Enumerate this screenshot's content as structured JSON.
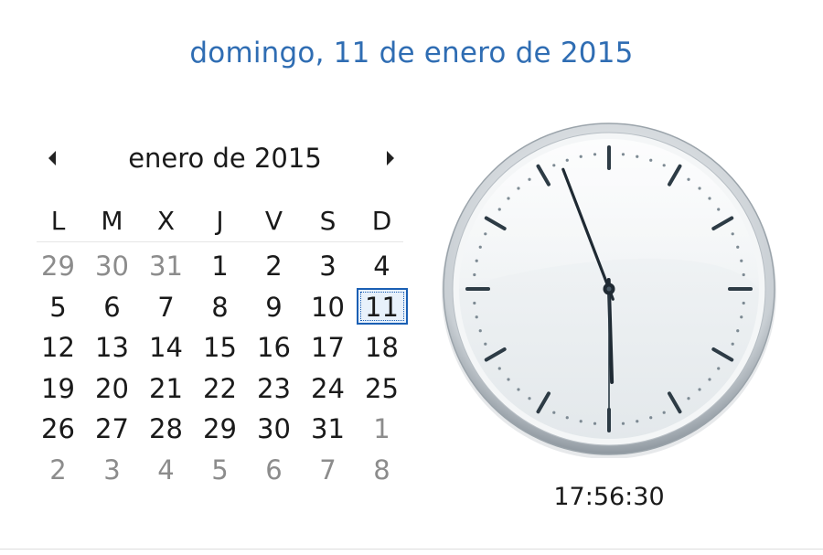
{
  "header": {
    "long_date": "domingo, 11 de enero de 2015"
  },
  "calendar": {
    "month_title": "enero de 2015",
    "prev_icon": "chevron-left-icon",
    "next_icon": "chevron-right-icon",
    "weekdays": [
      "L",
      "M",
      "X",
      "J",
      "V",
      "S",
      "D"
    ],
    "weeks": [
      [
        {
          "d": "29",
          "other": true
        },
        {
          "d": "30",
          "other": true
        },
        {
          "d": "31",
          "other": true
        },
        {
          "d": "1"
        },
        {
          "d": "2"
        },
        {
          "d": "3"
        },
        {
          "d": "4"
        }
      ],
      [
        {
          "d": "5"
        },
        {
          "d": "6"
        },
        {
          "d": "7"
        },
        {
          "d": "8"
        },
        {
          "d": "9"
        },
        {
          "d": "10"
        },
        {
          "d": "11",
          "today": true
        }
      ],
      [
        {
          "d": "12"
        },
        {
          "d": "13"
        },
        {
          "d": "14"
        },
        {
          "d": "15"
        },
        {
          "d": "16"
        },
        {
          "d": "17"
        },
        {
          "d": "18"
        }
      ],
      [
        {
          "d": "19"
        },
        {
          "d": "20"
        },
        {
          "d": "21"
        },
        {
          "d": "22"
        },
        {
          "d": "23"
        },
        {
          "d": "24"
        },
        {
          "d": "25"
        }
      ],
      [
        {
          "d": "26"
        },
        {
          "d": "27"
        },
        {
          "d": "28"
        },
        {
          "d": "29"
        },
        {
          "d": "30"
        },
        {
          "d": "31"
        },
        {
          "d": "1",
          "other": true
        }
      ],
      [
        {
          "d": "2",
          "other": true
        },
        {
          "d": "3",
          "other": true
        },
        {
          "d": "4",
          "other": true
        },
        {
          "d": "5",
          "other": true
        },
        {
          "d": "6",
          "other": true
        },
        {
          "d": "7",
          "other": true
        },
        {
          "d": "8",
          "other": true
        }
      ]
    ]
  },
  "clock": {
    "time_text": "17:56:30",
    "hours": 17,
    "minutes": 56,
    "seconds": 30,
    "colors": {
      "accent": "#2f6db3",
      "hand": "#1f2a33",
      "marks": "#2d3b45",
      "face": "#eef2f4"
    }
  }
}
